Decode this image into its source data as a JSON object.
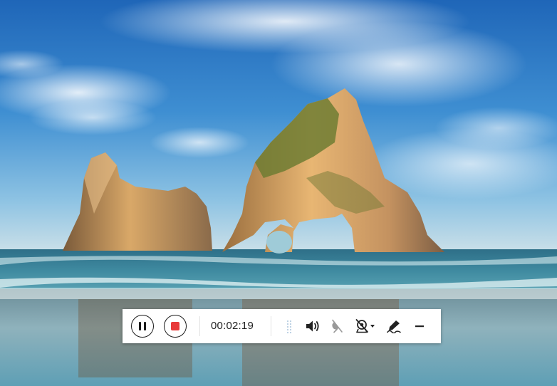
{
  "recorder": {
    "elapsed_time": "00:02:19",
    "controls": {
      "pause": "pause-icon",
      "stop": "stop-icon",
      "volume": "speaker-volume-icon",
      "microphone": "microphone-muted-icon",
      "webcam": "webcam-muted-dropdown-icon",
      "annotate": "pen-annotate-icon",
      "minimize": "minimize-icon"
    },
    "colors": {
      "stop": "#e83a3a",
      "icon": "#222222",
      "icon_disabled": "#999999",
      "toolbar_bg": "#ffffff"
    }
  }
}
